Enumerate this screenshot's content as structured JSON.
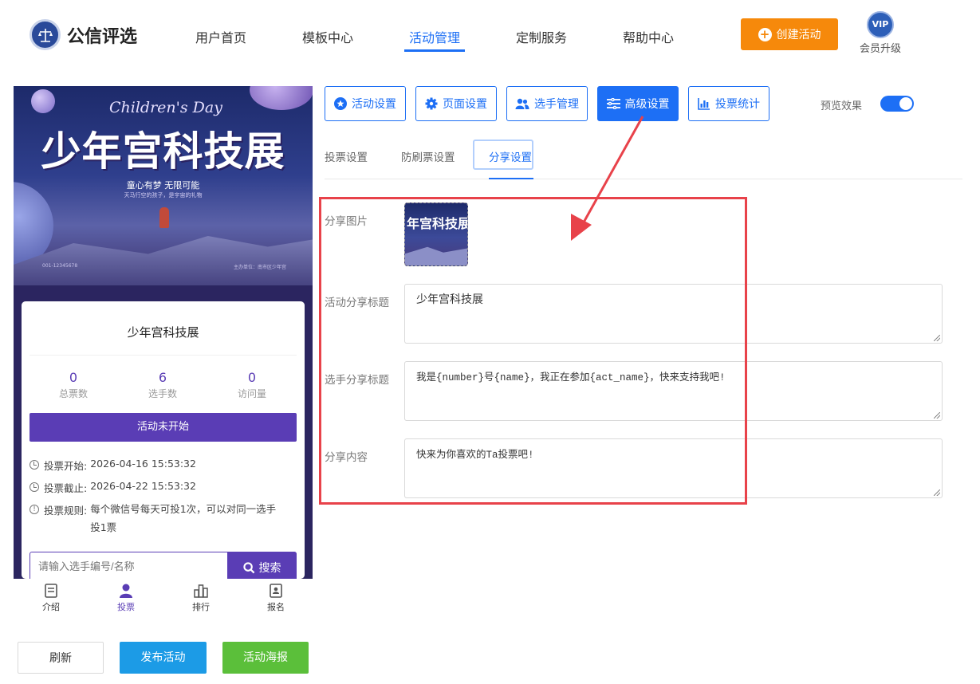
{
  "header": {
    "logo_text": "公信评选",
    "nav": [
      "用户首页",
      "模板中心",
      "活动管理",
      "定制服务",
      "帮助中心"
    ],
    "active_nav": "活动管理",
    "create_button": "创建活动",
    "vip_badge": "VIP",
    "vip_label": "会员升级"
  },
  "preview": {
    "banner": {
      "script_title": "Children's Day",
      "title": "少年宫科技展",
      "slogan": "童心有梦 无限可能",
      "sub_slogan": "天马行空的孩子，是宇宙的礼物",
      "footer_left": "001-12345678",
      "footer_right": "主办单位：南市区少年宫"
    },
    "activity_title": "少年宫科技展",
    "stats": [
      {
        "value": "0",
        "label": "总票数"
      },
      {
        "value": "6",
        "label": "选手数"
      },
      {
        "value": "0",
        "label": "访问量"
      }
    ],
    "status": "活动未开始",
    "vote_start_label": "投票开始:",
    "vote_start": "2026-04-16 15:53:32",
    "vote_end_label": "投票截止:",
    "vote_end": "2026-04-22 15:53:32",
    "rule_label": "投票规则:",
    "rule_line1": "每个微信号每天可投1次，可以对同一选手",
    "rule_line2": "投1票",
    "search_placeholder": "请输入选手编号/名称",
    "search_button": "搜索",
    "tabbar": [
      "介绍",
      "投票",
      "排行",
      "报名"
    ],
    "active_tab": "投票"
  },
  "bottom_buttons": {
    "refresh": "刷新",
    "publish": "发布活动",
    "poster": "活动海报"
  },
  "settings": {
    "top_tabs": [
      "活动设置",
      "页面设置",
      "选手管理",
      "高级设置",
      "投票统计"
    ],
    "active_top_tab": "高级设置",
    "preview_label": "预览效果",
    "preview_on": true,
    "sub_tabs": [
      "投票设置",
      "防刷票设置",
      "分享设置"
    ],
    "active_sub_tab": "分享设置",
    "form": {
      "share_image_label": "分享图片",
      "share_image_text": "年宫科技展",
      "activity_share_title_label": "活动分享标题",
      "activity_share_title_value": "少年宫科技展",
      "player_share_title_label": "选手分享标题",
      "player_share_title_value": "我是{number}号{name}，我正在参加{act_name}，快来支持我吧!",
      "share_content_label": "分享内容",
      "share_content_value": "快来为你喜欢的Ta投票吧!"
    }
  },
  "colors": {
    "primary": "#1d6ff5",
    "accent_orange": "#f6890b",
    "purple": "#5a3db5",
    "publish_blue": "#1c9be6",
    "poster_green": "#5bbf3a",
    "highlight_red": "#e8424a"
  }
}
